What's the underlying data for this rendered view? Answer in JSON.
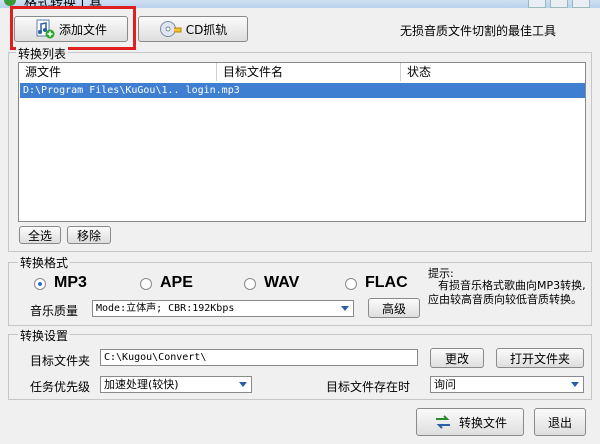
{
  "window": {
    "title": "格式转换工具"
  },
  "toolbar": {
    "add_file_label": "添加文件",
    "cd_rip_label": "CD抓轨",
    "slogan": "无损音质文件切割的最佳工具"
  },
  "convert_list": {
    "group_label": "转换列表",
    "columns": [
      "源文件",
      "目标文件名",
      "状态"
    ],
    "rows": [
      {
        "source": "D:\\Program Files\\KuGou\\1.. login.mp3",
        "target": "",
        "status": ""
      }
    ],
    "select_all_label": "全选",
    "remove_label": "移除"
  },
  "format": {
    "group_label": "转换格式",
    "options": [
      "MP3",
      "APE",
      "WAV",
      "FLAC"
    ],
    "selected": "MP3",
    "quality_label": "音乐质量",
    "quality_value": "Mode:立体声; CBR:192Kbps",
    "advanced_label": "高级",
    "hint_title": "提示:",
    "hint_text": "有损音乐格式歌曲向MP3转换,应由较高音质向较低音质转换。"
  },
  "settings": {
    "group_label": "转换设置",
    "target_folder_label": "目标文件夹",
    "target_folder_value": "C:\\Kugou\\Convert\\",
    "change_label": "更改",
    "open_folder_label": "打开文件夹",
    "priority_label": "任务优先级",
    "priority_value": "加速处理(较快)",
    "exists_label": "目标文件存在时",
    "exists_value": "询问"
  },
  "footer": {
    "convert_label": "转换文件",
    "exit_label": "退出"
  }
}
